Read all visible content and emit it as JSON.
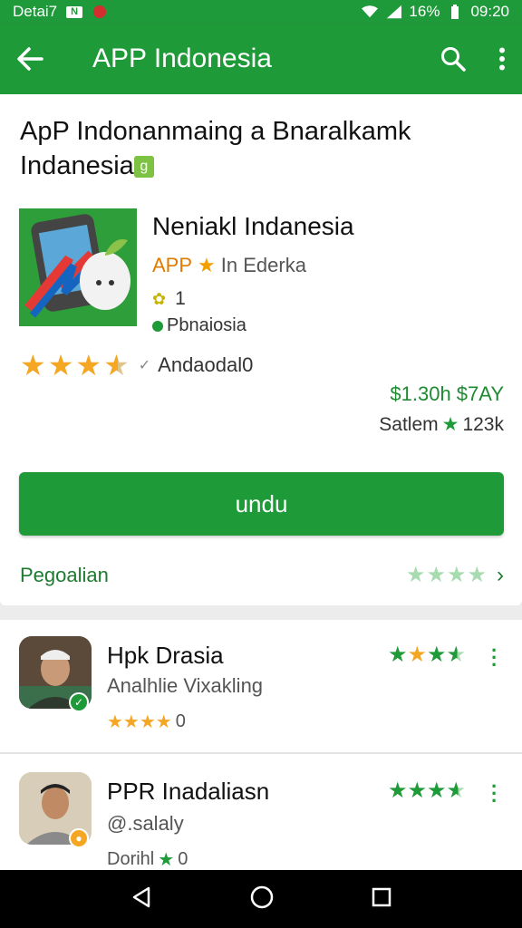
{
  "status_bar": {
    "left_text": "Detai7",
    "battery_text": "16%",
    "time": "09:20",
    "icons": [
      "n-icon",
      "notification-dot-icon",
      "wifi-icon",
      "signal-icon",
      "battery-icon"
    ]
  },
  "app_bar": {
    "title": "APP Indonesia",
    "back_icon": "arrow-left-icon",
    "search_icon": "search-icon",
    "more_icon": "more-vert-icon"
  },
  "listing": {
    "headline_line1": "ApP Indonanmaing a Bnaralkamk",
    "headline_line2": "Indanesia",
    "app_name": "Neniakl Indanesia",
    "brand": "APP",
    "category": "In Ederka",
    "count": "1",
    "developer": "Pbnaiosia",
    "review_text": "Andaodal0",
    "price": "$1.30h $7AY",
    "sales_label": "Satlem",
    "sales_value": "123k",
    "rating_stars": 3.5,
    "download_label": "undu",
    "more_label": "Pegoalian"
  },
  "related": [
    {
      "name": "Hpk Drasia",
      "subtitle": "Analhlie Vixakling",
      "rating_value": "0",
      "stars": 4
    },
    {
      "name": "PPR Inadaliasn",
      "subtitle": "@.salaly",
      "rating_label": "Dorihl",
      "rating_value": "0",
      "stars": 4
    }
  ],
  "colors": {
    "primary_green": "#1e9a38",
    "star_gold": "#f5a623",
    "brand_orange": "#e07b00"
  }
}
